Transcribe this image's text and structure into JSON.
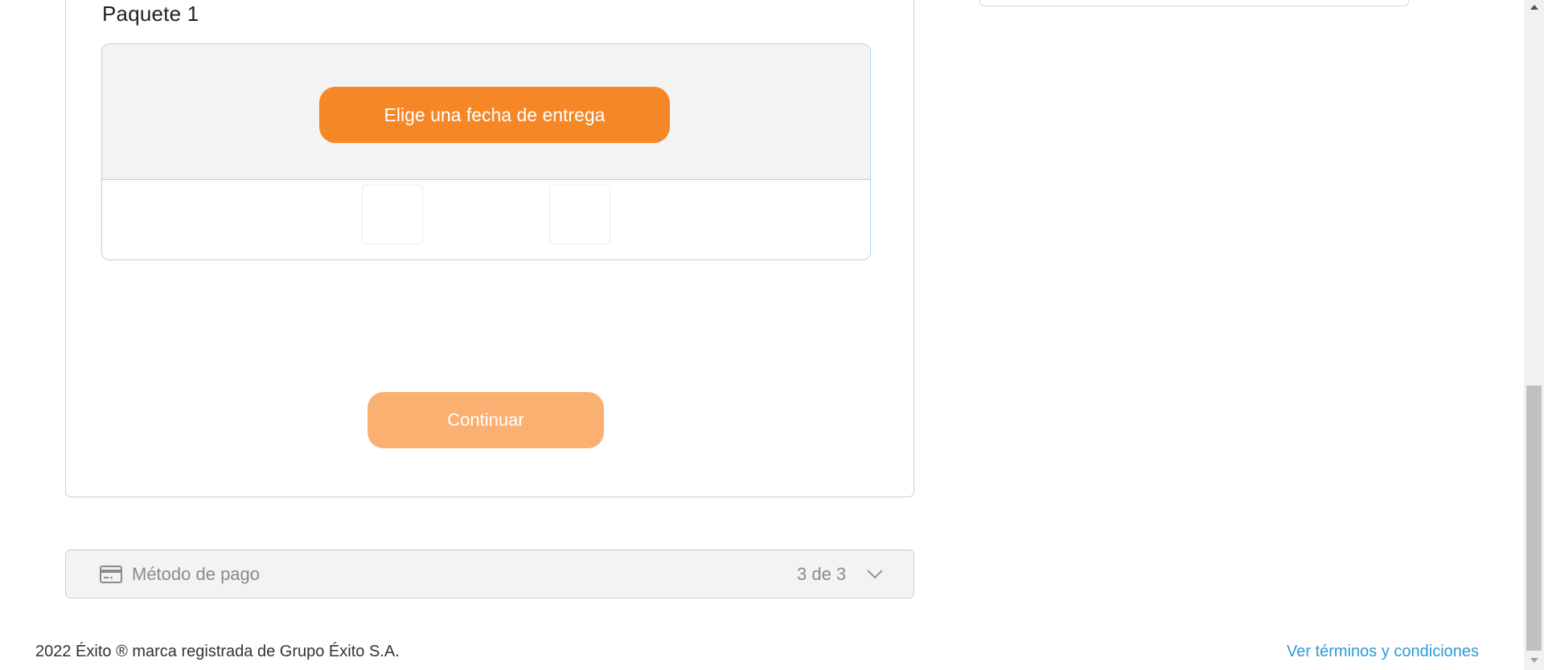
{
  "package": {
    "title": "Paquete 1",
    "date_button_label": "Elige una fecha de entrega"
  },
  "continue_label": "Continuar",
  "payment": {
    "label": "Método de pago",
    "step": "3 de 3",
    "icon": "credit-card-icon"
  },
  "footer": {
    "copyright": "2022 Éxito ® marca registrada de Grupo Éxito S.A.",
    "terms_link": "Ver términos y condiciones"
  },
  "colors": {
    "accent": "#f68726",
    "accent_disabled": "#f9b071",
    "link": "#2c9ad6",
    "box_border": "#a9d3ef"
  }
}
